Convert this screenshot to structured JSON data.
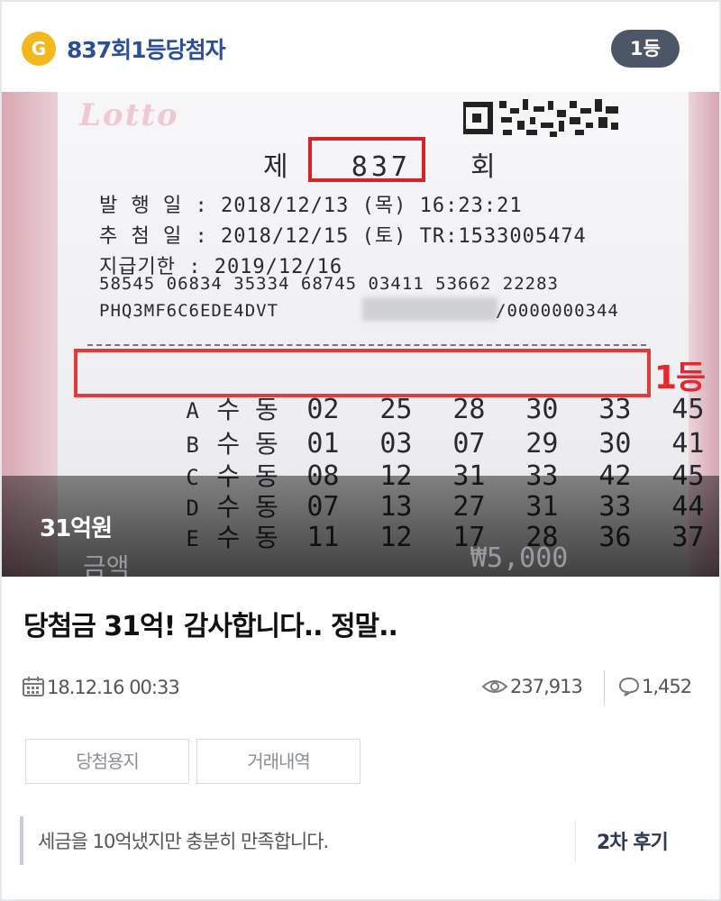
{
  "header": {
    "badge_letter": "G",
    "title": "837회1등당첨자",
    "rank_pill": "1등"
  },
  "ticket": {
    "logo_text": "Lotto",
    "round_prefix": "제",
    "round_number": "837",
    "round_suffix": "회",
    "issue_line": "발 행 일 : 2018/12/13 (목) 16:23:21",
    "draw_line": "추 첨 일 : 2018/12/15 (토) TR:1533005474",
    "deadline_line": "지급기한 : 2019/12/16",
    "serial_line": "58545 06834 35334 68745 03411 53662 22283",
    "code_line": "PHQ3MF6C6EDE4DVT",
    "code_suffix": "/0000000344",
    "games": [
      {
        "letter": "A",
        "type": "수 동",
        "numbers": [
          "02",
          "25",
          "28",
          "30",
          "33",
          "45"
        ]
      },
      {
        "letter": "B",
        "type": "수 동",
        "numbers": [
          "01",
          "03",
          "07",
          "29",
          "30",
          "41"
        ]
      },
      {
        "letter": "C",
        "type": "수 동",
        "numbers": [
          "08",
          "12",
          "31",
          "33",
          "42",
          "45"
        ]
      },
      {
        "letter": "D",
        "type": "수 동",
        "numbers": [
          "07",
          "13",
          "27",
          "31",
          "33",
          "44"
        ]
      },
      {
        "letter": "E",
        "type": "수 동",
        "numbers": [
          "11",
          "12",
          "17",
          "28",
          "36",
          "37"
        ]
      }
    ],
    "winning_tag": "1등",
    "footer_left": "금액",
    "footer_right": "₩5,000",
    "amount_overlay": "31억원"
  },
  "post": {
    "title": "당첨금 31억! 감사합니다.. 정말..",
    "date": "18.12.16 00:33",
    "views": "237,913",
    "comments": "1,452"
  },
  "tags": [
    "당첨용지",
    "거래내역"
  ],
  "review": {
    "text": "세금을 10억냈지만 충분히 만족합니다.",
    "link": "2차 후기"
  },
  "colors": {
    "title_blue": "#2b4f98",
    "badge_gold": "#f3b81c",
    "pill_gray": "#4c5667",
    "highlight_red": "#e53a3a"
  },
  "icons": [
    "calendar-icon",
    "eye-icon",
    "comment-icon",
    "qr-code-icon"
  ]
}
